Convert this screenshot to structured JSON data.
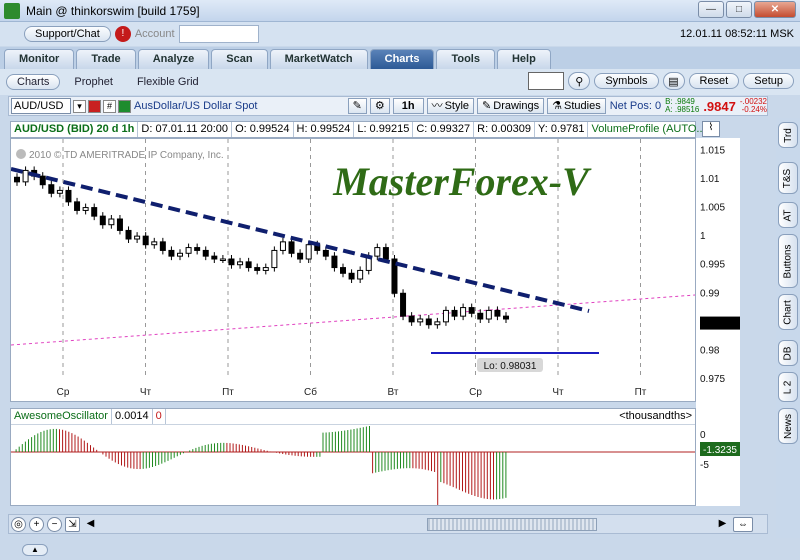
{
  "window": {
    "title": "Main @ thinkorswim [build 1759]",
    "min": "—",
    "max": "□",
    "close": "✕"
  },
  "topbar": {
    "support_label": "Support/Chat",
    "alert_glyph": "!",
    "account_label": "Account",
    "datetime": "12.01.11 08:52:11 MSK"
  },
  "main_tabs": [
    "Monitor",
    "Trade",
    "Analyze",
    "Scan",
    "MarketWatch",
    "Charts",
    "Tools",
    "Help"
  ],
  "sub_tabs": [
    "Charts",
    "Prophet",
    "Flexible Grid"
  ],
  "sub_controls": {
    "symbols": "Symbols",
    "reset": "Reset",
    "setup": "Setup"
  },
  "toolbar": {
    "symbol": "AUD/USD",
    "hash": "#",
    "description": "AusDollar/US Dollar Spot",
    "timeframe": "1h",
    "style": "Style",
    "drawings": "Drawings",
    "studies": "Studies",
    "netpos": "Net Pos: 0",
    "bid": "B: .9849",
    "ask": "A: .98516",
    "last": ".9847",
    "chg": "-.00232",
    "chg_pct": "-0.24%"
  },
  "infobar": {
    "symbol": "AUD/USD (BID) 20 d 1h",
    "d": "D: 07.01.11 20:00",
    "o": "O: 0.99524",
    "h": "H: 0.99524",
    "l": "L: 0.99215",
    "c": "C: 0.99327",
    "r": "R: 0.00309",
    "y": "Y: 0.9781",
    "vp": "VolumeProfile (AUTO..."
  },
  "chart": {
    "copyright": "2010 © TD AMERITRADE IP Company, Inc.",
    "watermark": "MasterForex-V",
    "lo_label": "Lo: 0.98031",
    "y_ticks": [
      "1.015",
      "1.01",
      "1.005",
      "1",
      "0.995",
      "0.99",
      "0.985",
      "0.98",
      "0.975"
    ],
    "x_ticks": [
      "Ср",
      "Чт",
      "Пт",
      "Сб",
      "Вт",
      "Ср",
      "Чт",
      "Пт"
    ]
  },
  "chart_data": {
    "type": "candlestick",
    "series": [
      {
        "name": "AUD/USD (BID) 20 d 1h",
        "values": [
          1.0095,
          1.0115,
          1.0105,
          1.009,
          1.0075,
          1.008,
          1.006,
          1.0045,
          1.005,
          1.0035,
          1.002,
          1.003,
          1.001,
          0.9995,
          1.0,
          0.9985,
          0.999,
          0.9975,
          0.9965,
          0.997,
          0.998,
          0.9975,
          0.9965,
          0.996,
          0.996,
          0.995,
          0.9955,
          0.9945,
          0.994,
          0.9945,
          0.9975,
          0.999,
          0.997,
          0.996,
          0.9985,
          0.9975,
          0.9965,
          0.9945,
          0.9935,
          0.9925,
          0.994,
          0.9965,
          0.998,
          0.996,
          0.99,
          0.986,
          0.985,
          0.9855,
          0.9845,
          0.985,
          0.987,
          0.986,
          0.9875,
          0.9865,
          0.9855,
          0.987,
          0.986,
          0.9855
        ]
      }
    ],
    "ylim": [
      0.975,
      1.017
    ],
    "lo": 0.98031
  },
  "oscillator": {
    "name": "AwesomeOscillator",
    "value": "0.0014",
    "zero": "0",
    "units": "<thousandths>",
    "ticks": [
      "0",
      "-5"
    ],
    "badge": "-1.3235"
  },
  "sidebar": [
    "Trd",
    "T&S",
    "AT",
    "Buttons",
    "Chart",
    "DB",
    "L 2",
    "News"
  ],
  "colors": {
    "trend": "#0f1f6e",
    "watermark": "#2f6b16",
    "candle": "#000000",
    "pos": "#b01818",
    "neg": "#1f8a1f"
  }
}
